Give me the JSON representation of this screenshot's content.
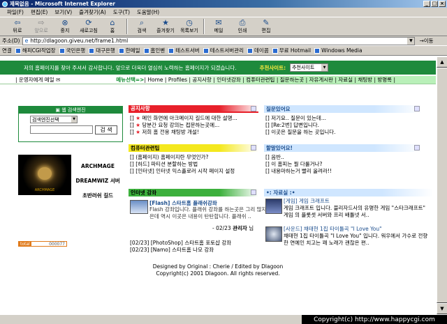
{
  "window": {
    "title": "제목없음 - Microsoft Internet Explorer",
    "buttons": [
      "_",
      "□",
      "×"
    ]
  },
  "menubar": [
    "파일(F)",
    "편집(E)",
    "보기(V)",
    "즐겨찾기(A)",
    "도구(T)",
    "도움말(H)"
  ],
  "toolbar": [
    {
      "label": "뒤로",
      "icon": "back-arrow-icon",
      "glyph": "⇦",
      "enabled": true
    },
    {
      "label": "앞으로",
      "icon": "forward-arrow-icon",
      "glyph": "⇨",
      "enabled": false
    },
    {
      "label": "중지",
      "icon": "stop-icon",
      "glyph": "⊗",
      "enabled": true
    },
    {
      "label": "새로고침",
      "icon": "refresh-icon",
      "glyph": "⟳",
      "enabled": true
    },
    {
      "label": "홈",
      "icon": "home-icon",
      "glyph": "⌂",
      "enabled": true
    },
    {
      "label": "검색",
      "icon": "search-icon",
      "glyph": "⌕",
      "enabled": true
    },
    {
      "label": "즐겨찾기",
      "icon": "favorites-icon",
      "glyph": "★",
      "enabled": true
    },
    {
      "label": "목록보기",
      "icon": "history-icon",
      "glyph": "◷",
      "enabled": true
    },
    {
      "label": "메일",
      "icon": "mail-icon",
      "glyph": "✉",
      "enabled": true
    },
    {
      "label": "인쇄",
      "icon": "print-icon",
      "glyph": "⎙",
      "enabled": true
    },
    {
      "label": "편집",
      "icon": "edit-icon",
      "glyph": "✎",
      "enabled": true
    }
  ],
  "address": {
    "label": "주소(D)",
    "url": "http://dlagoon.giveu.net/frame1.html",
    "go": "이동"
  },
  "links": {
    "label": "연결",
    "items": [
      "해피CGI작업장",
      "국민은행",
      "대구은행",
      "한메일",
      "홈인벤",
      "테스트서버",
      "테스트서버관리",
      "데이콤",
      "무료 Hotmail",
      "Windows Media"
    ]
  },
  "page": {
    "green_msg": "저의 홈페이지를 찾아 주셔서 감사합니다. 앞으로 더욱더 열심히 노력하는 홈페이지가 되겠습니다.",
    "recommend_label": "추천사이트:",
    "recommend_value": "추천사이트",
    "owner_mail": "운영자에게 메일",
    "menu_select": "메뉴선택=>",
    "nav": [
      "Home",
      "Profiles",
      "공지사항",
      "인터넷강좌",
      "컴퓨터관련팁",
      "질문하는곳",
      "자유게시판",
      "자료실",
      "채팅방",
      "방명록"
    ],
    "search": {
      "title": "웹 검색엔진",
      "select": "검색엔진선택",
      "button": "검 색"
    },
    "banner": {
      "lines": [
        "ARCHMAGE",
        "DREAMWIZ 서버",
        "초반러쉬 길드"
      ],
      "caption": "ARCHMAGE"
    },
    "counter": {
      "label": "total",
      "value": "000077"
    },
    "notice": {
      "title": "공지사항",
      "items": [
        "[] ★ 메인 화면에 아크메이지 길드에 대한 설명...",
        "[] ★ 당분간 요청 강의는 접문하는곳에...",
        "[] ★ 저희 홈 전용 채팅방 개설!"
      ]
    },
    "qna": {
      "title": "질문있어요",
      "items": [
        "[] 저기요.. 질문이 있는데...",
        "[] [Re:2번] 답변입니다.",
        "[] 이곳은 질문을 하는 곳입니다."
      ]
    },
    "tips": {
      "title": "컴퓨터관련팁",
      "items": [
        "[] (홈페이지) 홈페이지란 무엇인가?",
        "[] [하드] 파티션 분할하는 방법",
        "[] [인터넷] 인터넷 익스플로러 시작 페이지 설정"
      ]
    },
    "free": {
      "title": "할말있어요!",
      "items": [
        "[] 음반..",
        "[] 이 홈피는 뭘 다룰거나?",
        "[] 내용마하는거 빨리 올려라!!"
      ]
    },
    "lecture": {
      "title": "인터넷 강좌",
      "item_title": "[Flash] 스타트홈 플래쉬강좌",
      "desc": "Flash 강좌입니다. 플래쉬 강좌를 하는곳은 그리 많지 않은데 역시 이곳은 내용이 탄탄합니다. 플래쉬 ..",
      "date": "- 02/23",
      "author": "관리자",
      "author_suffix": "님",
      "list": [
        "[02/23] [PhotoShop] 스타트홈 포토샵 강좌",
        "[02/23] [Namo] 스타트홈 나모 강좌"
      ]
    },
    "data": {
      "title": "•: 자료실 :•",
      "items": [
        {
          "head": "[게임] 게임 크래프트",
          "body": "게임 크래프트 입니다. 블리자드사의 유명한 게임 \"스타크래프트\" 게임 의 플롯셋 서버와 프리 배틀넷 서.."
        },
        {
          "head": "[사운드] 채태현 1집 타이틀곡 \"I Love You\"",
          "body": "채태현 1집 타이틀곡 \"I Love You\" 입니다. 워우에서 가수로 전향한 연예인 치고는 꽤 노래가 괜찮은 편.."
        }
      ]
    },
    "footer": [
      "Designed by Original : Cherie / Edited by Dlagoon",
      "Copyright(c) 2001 Dlagoon. All rights reserved."
    ]
  },
  "overlay": "Copyright(c) http://www.happycgi.com"
}
